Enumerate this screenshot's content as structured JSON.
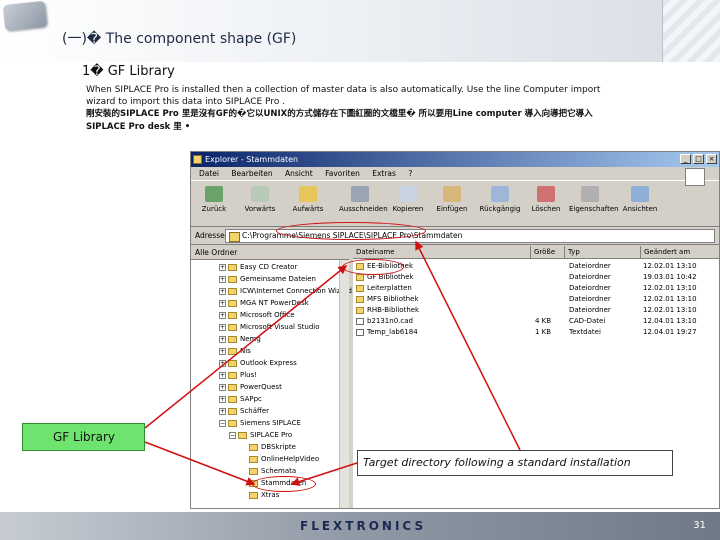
{
  "slide": {
    "title": "(一)� The component shape (GF)",
    "subtitle": "1� GF Library",
    "para_en_1": "When SIPLACE Pro is installed then a collection of master data is also automatically. Use the line Computer import",
    "para_en_2": "wizard to import this data into SIPLACE Pro .",
    "para_cn_1": "剛安裝的SIPLACE Pro 里是沒有GF的�它以UNIX的方式儲存在下圖紅圈的文檔里� 所以要用Line computer 導入向導把它導入",
    "para_cn_2": "SIPLACE Pro desk 里 •",
    "gf_label": "GF Library",
    "target_label": "Target directory following a standard installation",
    "footer_logo": "FLEXTRONICS",
    "page_number": "31"
  },
  "explorer": {
    "window_title": "Explorer - Stammdaten",
    "menu": [
      "Datei",
      "Bearbeiten",
      "Ansicht",
      "Favoriten",
      "Extras",
      "?"
    ],
    "toolbar": [
      "Zurück",
      "Vorwärts",
      "Aufwärts",
      "Ausschneiden",
      "Kopieren",
      "Einfügen",
      "Rückgängig",
      "Löschen",
      "Eigenschaften",
      "Ansichten"
    ],
    "address_label": "Adresse",
    "address_value": "C:\\Programme\\Siemens SIPLACE\\SIPLACE Pro\\Stammdaten",
    "tree_header": "Alle Ordner",
    "tree": [
      {
        "label": "Easy CD Creator"
      },
      {
        "label": "Gemeinsame Dateien"
      },
      {
        "label": "ICW\\Internet Connection Wizard"
      },
      {
        "label": "MGA NT PowerDesk"
      },
      {
        "label": "Microsoft Office"
      },
      {
        "label": "Microsoft Visual Studio"
      },
      {
        "label": "Nemg"
      },
      {
        "label": "Nis"
      },
      {
        "label": "Outlook Express"
      },
      {
        "label": "Plus!"
      },
      {
        "label": "PowerQuest"
      },
      {
        "label": "SAPpc"
      },
      {
        "label": "Schäffer"
      },
      {
        "label": "Siemens SIPLACE"
      },
      {
        "label": "SIPLACE Pro"
      },
      {
        "label": "DBSkripte"
      },
      {
        "label": "OnlineHelpVideo"
      },
      {
        "label": "Schemata"
      },
      {
        "label": "Stammdaten"
      },
      {
        "label": "Xtras"
      }
    ],
    "columns": [
      "Dateiname",
      "Größe",
      "Typ",
      "Geändert am"
    ],
    "files": [
      {
        "name": "EE-Bibliothek",
        "size": "",
        "type": "Dateiordner",
        "date": "12.02.01 13:10"
      },
      {
        "name": "GF Bibliothek",
        "size": "",
        "type": "Dateiordner",
        "date": "19.03.01 10:42"
      },
      {
        "name": "Leiterplatten",
        "size": "",
        "type": "Dateiordner",
        "date": "12.02.01 13:10"
      },
      {
        "name": "MFS Bibliothek",
        "size": "",
        "type": "Dateiordner",
        "date": "12.02.01 13:10"
      },
      {
        "name": "RHB-Bibliothek",
        "size": "",
        "type": "Dateiordner",
        "date": "12.02.01 13:10"
      },
      {
        "name": "b2131n0.cad",
        "size": "4 KB",
        "type": "CAD-Datei",
        "date": "12.04.01 13:10"
      },
      {
        "name": "Temp_lab6184",
        "size": "1 KB",
        "type": "Textdatei",
        "date": "12.04.01 19:27"
      }
    ]
  }
}
